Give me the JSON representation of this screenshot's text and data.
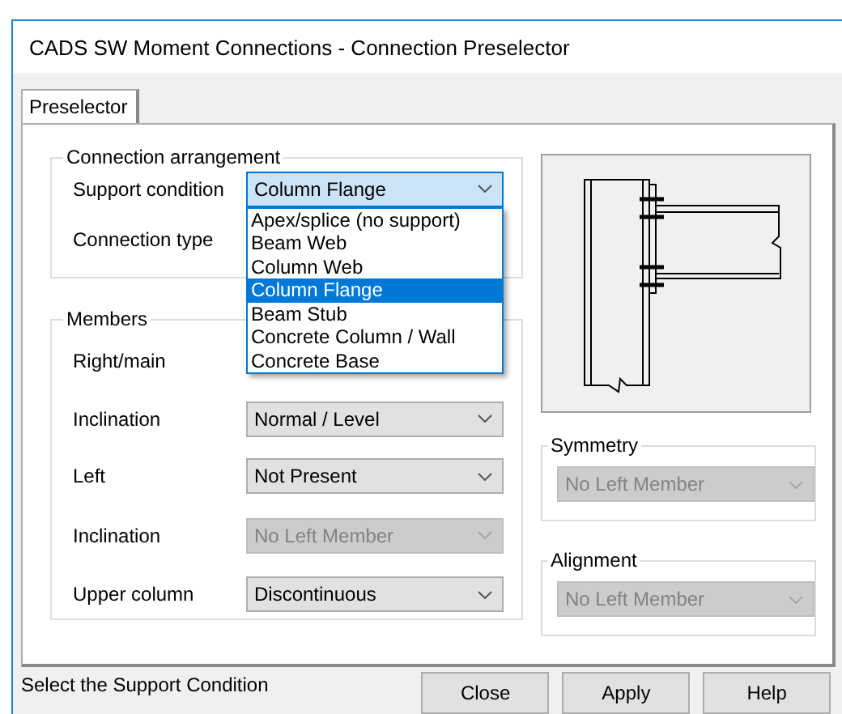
{
  "window": {
    "title": "CADS SW Moment Connections - Connection Preselector"
  },
  "tabs": [
    {
      "label": "Preselector",
      "selected": true
    }
  ],
  "connection_arrangement": {
    "title": "Connection arrangement",
    "rows": [
      {
        "label": "Support condition",
        "value": "Column Flange",
        "open": true,
        "options": [
          {
            "label": "Apex/splice (no support)",
            "selected": false
          },
          {
            "label": "Beam Web",
            "selected": false
          },
          {
            "label": "Column Web",
            "selected": false
          },
          {
            "label": "Column Flange",
            "selected": true
          },
          {
            "label": "Beam Stub",
            "selected": false
          },
          {
            "label": "Concrete Column / Wall",
            "selected": false
          },
          {
            "label": "Concrete Base",
            "selected": false
          }
        ]
      },
      {
        "label": "Connection type"
      }
    ]
  },
  "members": {
    "title": "Members",
    "rows": [
      {
        "label": "Right/main"
      },
      {
        "label": "Inclination",
        "value": "Normal / Level",
        "disabled": false
      },
      {
        "label": "Left",
        "value": "Not Present",
        "disabled": false
      },
      {
        "label": "Inclination",
        "value": "No Left Member",
        "disabled": true
      },
      {
        "label": "Upper column",
        "value": "Discontinuous",
        "disabled": false
      }
    ]
  },
  "symmetry": {
    "title": "Symmetry",
    "value": "No Left Member",
    "disabled": true
  },
  "alignment": {
    "title": "Alignment",
    "value": "No Left Member",
    "disabled": true
  },
  "status_bar": {
    "text": "Select the Support Condition"
  },
  "buttons": [
    "Close",
    "Apply",
    "Help"
  ]
}
